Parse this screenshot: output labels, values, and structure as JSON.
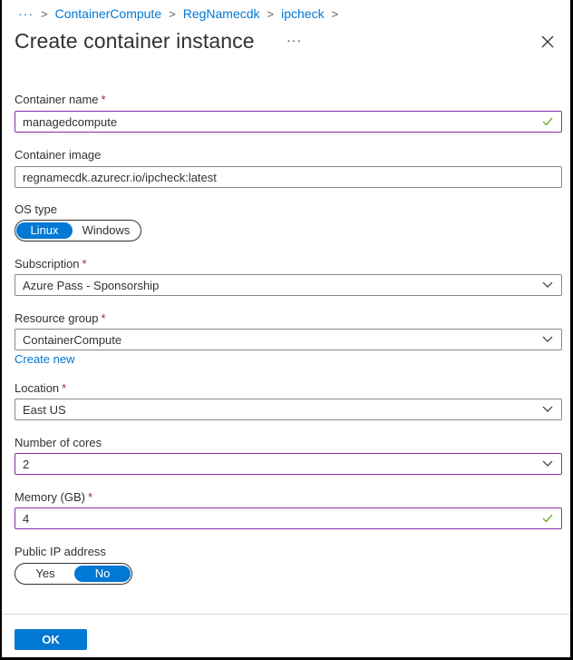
{
  "breadcrumb": {
    "overflow": "···",
    "items": [
      "ContainerCompute",
      "RegNamecdk",
      "ipcheck"
    ],
    "separator": ">"
  },
  "header": {
    "title": "Create container instance",
    "more": "···",
    "close_icon": "close-icon"
  },
  "form": {
    "container_name": {
      "label": "Container name",
      "required": "*",
      "value": "managedcompute",
      "status": "valid"
    },
    "container_image": {
      "label": "Container image",
      "value": "regnamecdk.azurecr.io/ipcheck:latest"
    },
    "os_type": {
      "label": "OS type",
      "options": [
        "Linux",
        "Windows"
      ],
      "selected": "Linux"
    },
    "subscription": {
      "label": "Subscription",
      "required": "*",
      "value": "Azure Pass - Sponsorship"
    },
    "resource_group": {
      "label": "Resource group",
      "required": "*",
      "value": "ContainerCompute",
      "create_new": "Create new"
    },
    "location": {
      "label": "Location",
      "required": "*",
      "value": "East US"
    },
    "cores": {
      "label": "Number of cores",
      "value": "2"
    },
    "memory": {
      "label": "Memory (GB)",
      "required": "*",
      "value": "4",
      "status": "valid"
    },
    "public_ip": {
      "label": "Public IP address",
      "options": [
        "Yes",
        "No"
      ],
      "selected": "No"
    }
  },
  "footer": {
    "ok_label": "OK"
  },
  "colors": {
    "accent": "#0078d4",
    "required": "#a4262c",
    "valid_border": "#8a2da5",
    "check": "#57a300"
  }
}
